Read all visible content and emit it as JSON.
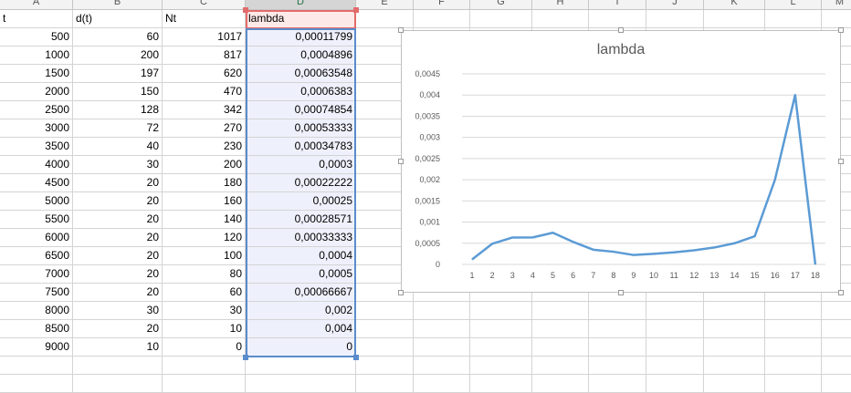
{
  "columns": [
    "A",
    "B",
    "C",
    "D",
    "E",
    "F",
    "G",
    "H",
    "I",
    "J",
    "K",
    "L",
    "M"
  ],
  "headers": {
    "a": "t",
    "b": "d(t)",
    "c": "Nt",
    "d": "lambda"
  },
  "rows": [
    {
      "t": "500",
      "dt": "60",
      "nt": "1017",
      "lambda": "0,00011799"
    },
    {
      "t": "1000",
      "dt": "200",
      "nt": "817",
      "lambda": "0,0004896"
    },
    {
      "t": "1500",
      "dt": "197",
      "nt": "620",
      "lambda": "0,00063548"
    },
    {
      "t": "2000",
      "dt": "150",
      "nt": "470",
      "lambda": "0,0006383"
    },
    {
      "t": "2500",
      "dt": "128",
      "nt": "342",
      "lambda": "0,00074854"
    },
    {
      "t": "3000",
      "dt": "72",
      "nt": "270",
      "lambda": "0,00053333"
    },
    {
      "t": "3500",
      "dt": "40",
      "nt": "230",
      "lambda": "0,00034783"
    },
    {
      "t": "4000",
      "dt": "30",
      "nt": "200",
      "lambda": "0,0003"
    },
    {
      "t": "4500",
      "dt": "20",
      "nt": "180",
      "lambda": "0,00022222"
    },
    {
      "t": "5000",
      "dt": "20",
      "nt": "160",
      "lambda": "0,00025"
    },
    {
      "t": "5500",
      "dt": "20",
      "nt": "140",
      "lambda": "0,00028571"
    },
    {
      "t": "6000",
      "dt": "20",
      "nt": "120",
      "lambda": "0,00033333"
    },
    {
      "t": "6500",
      "dt": "20",
      "nt": "100",
      "lambda": "0,0004"
    },
    {
      "t": "7000",
      "dt": "20",
      "nt": "80",
      "lambda": "0,0005"
    },
    {
      "t": "7500",
      "dt": "20",
      "nt": "60",
      "lambda": "0,00066667"
    },
    {
      "t": "8000",
      "dt": "30",
      "nt": "30",
      "lambda": "0,002"
    },
    {
      "t": "8500",
      "dt": "20",
      "nt": "10",
      "lambda": "0,004"
    },
    {
      "t": "9000",
      "dt": "10",
      "nt": "0",
      "lambda": "0"
    }
  ],
  "chart_data": {
    "type": "line",
    "title": "lambda",
    "categories": [
      "1",
      "2",
      "3",
      "4",
      "5",
      "6",
      "7",
      "8",
      "9",
      "10",
      "11",
      "12",
      "13",
      "14",
      "15",
      "16",
      "17",
      "18"
    ],
    "series": [
      {
        "values": [
          0.00011799,
          0.0004896,
          0.00063548,
          0.0006383,
          0.00074854,
          0.00053333,
          0.00034783,
          0.0003,
          0.00022222,
          0.00025,
          0.00028571,
          0.00033333,
          0.0004,
          0.0005,
          0.00066667,
          0.002,
          0.004,
          0
        ]
      }
    ],
    "ylim": [
      0,
      0.0045
    ],
    "yticks": [
      "0",
      "0,0005",
      "0,001",
      "0,0015",
      "0,002",
      "0,0025",
      "0,003",
      "0,0035",
      "0,004",
      "0,0045"
    ],
    "grid": true,
    "legend": "none",
    "line_color": "#5b9bd5"
  }
}
